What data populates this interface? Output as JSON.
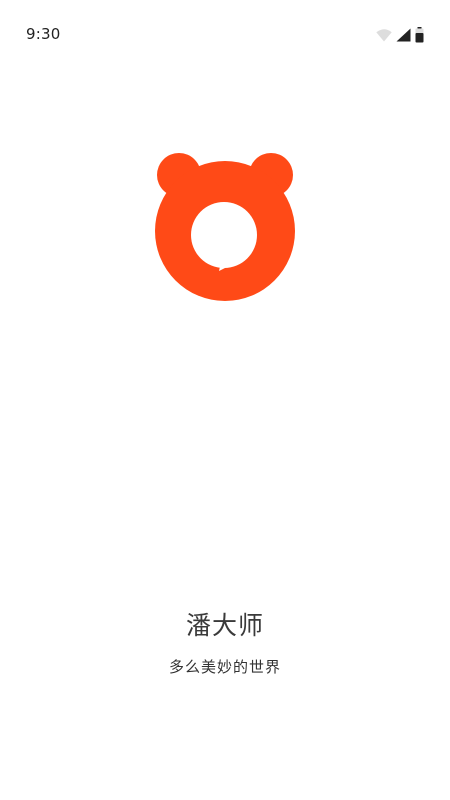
{
  "status_bar": {
    "time": "9:30",
    "icons": [
      "wifi-icon",
      "cellular-signal-icon",
      "battery-icon"
    ]
  },
  "logo": {
    "icon": "bear-chat-bubble-logo",
    "color": "#FF4A17"
  },
  "splash": {
    "app_name": "潘大师",
    "slogan": "多么美妙的世界"
  }
}
